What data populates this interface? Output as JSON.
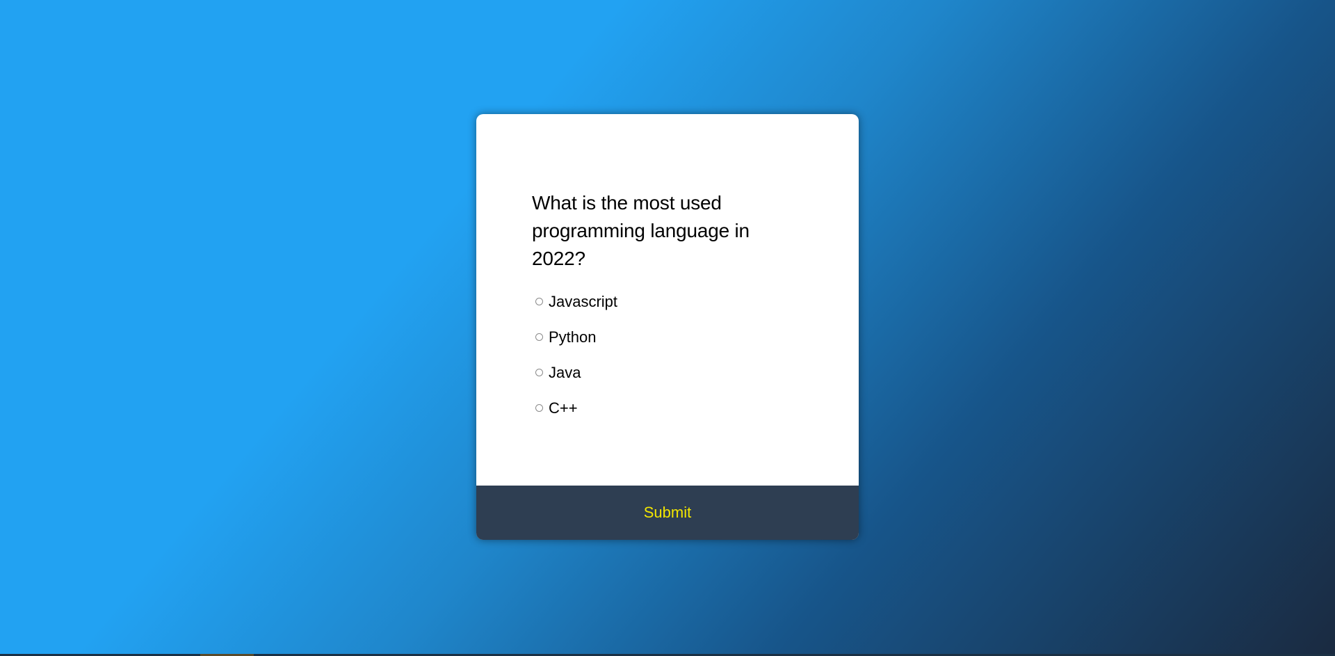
{
  "quiz": {
    "question": "What is the most used programming language in 2022?",
    "answers": [
      {
        "label": "Javascript"
      },
      {
        "label": "Python"
      },
      {
        "label": "Java"
      },
      {
        "label": "C++"
      }
    ],
    "submit_label": "Submit"
  },
  "colors": {
    "card_background": "#ffffff",
    "footer_background": "#2e3e52",
    "submit_text": "#f3e600",
    "page_gradient_start": "#22a2f2",
    "page_gradient_end": "#1a2a40"
  }
}
